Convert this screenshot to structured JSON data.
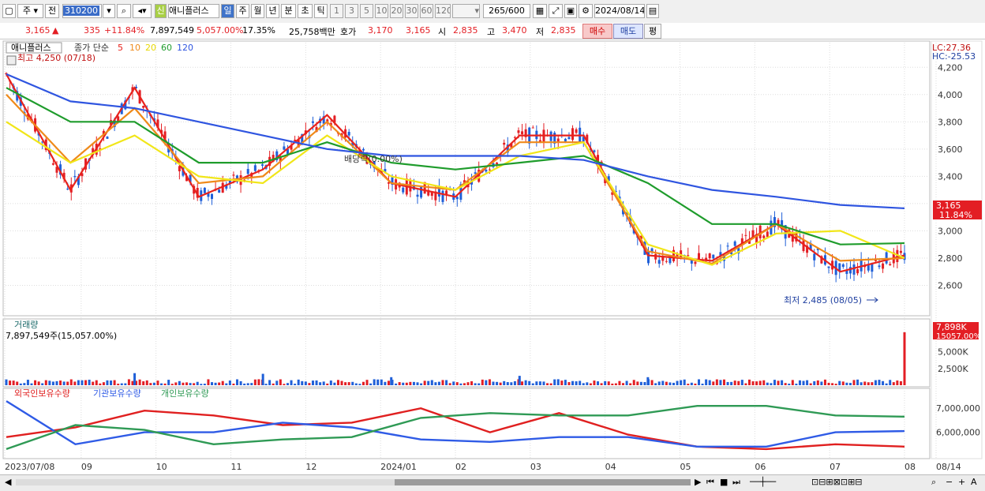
{
  "toolbar": {
    "market_label": "주",
    "prev_label": "전",
    "code": "310200",
    "new_badge": "신",
    "stock_name": "애니플러스",
    "periods": [
      "일",
      "주",
      "월",
      "년",
      "분",
      "초",
      "틱"
    ],
    "intervals": [
      "1",
      "3",
      "5",
      "10",
      "20",
      "30",
      "60",
      "120"
    ],
    "count": "265",
    "count_total": "/600",
    "date": "2024/08/14"
  },
  "quote": {
    "price": "3,165",
    "change": "335",
    "change_rate": "+11.84%",
    "volume": "7,897,549",
    "volume_rate": "5,057.00%",
    "turnover": "17.35%",
    "amount": "25,758백만",
    "bid_label": "호가",
    "ask_price": "3,170",
    "bid_price": "3,165",
    "open_label": "시",
    "open": "2,835",
    "high_label": "고",
    "high": "3,470",
    "low_label": "저",
    "low": "2,835",
    "buy_label": "매수",
    "sell_label": "매도",
    "eval_label": "평"
  },
  "price_panel": {
    "stock_label": "애니플러스",
    "ma_title": "종가 단순",
    "ma_periods": [
      "5",
      "10",
      "20",
      "60",
      "120"
    ],
    "high_marker": "최고 4,250 (07/18)",
    "low_marker": "최저 2,485 (08/05)",
    "dividend_marker": "배당락(0.00%)",
    "lc": "LC:27.36",
    "hc": "HC:-25.53",
    "price_tag": "3,165",
    "pct_tag": "11.84%",
    "y_ticks": [
      "4,200",
      "4,000",
      "3,800",
      "3,600",
      "3,400",
      "3,200",
      "3,000",
      "2,800",
      "2,600"
    ]
  },
  "volume_panel": {
    "title": "거래량",
    "value": "7,897,549주(15,057.00%)",
    "tag": "7,898K",
    "tag2": "15057.00%",
    "y_ticks": [
      "5,000K",
      "2,500K"
    ]
  },
  "holders_panel": {
    "legend": [
      "외국인보유수량",
      "기관보유수량",
      "개인보유수량"
    ],
    "y_ticks": [
      "7,000,000",
      "6,000,000"
    ]
  },
  "x_labels": [
    "2023/07/08",
    "09",
    "10",
    "11",
    "12",
    "2024/01",
    "02",
    "03",
    "04",
    "05",
    "06",
    "07",
    "08",
    "08/14"
  ],
  "colors": {
    "up": "#e31e24",
    "down": "#1f5fd8",
    "ma5": "#e8221c",
    "ma10": "#ef8a1a",
    "ma20": "#f1e619",
    "ma60": "#1f9c2c",
    "ma120": "#2f55e0",
    "foreign": "#e02020",
    "inst": "#2f5be6",
    "retail": "#2f9a55"
  },
  "chart_data": [
    {
      "type": "line",
      "title": "애니플러스",
      "x": [
        "2023/07",
        "2023/08",
        "2023/09",
        "2023/10",
        "2023/11",
        "2023/12",
        "2024/01",
        "2024/02",
        "2024/03",
        "2024/04",
        "2024/05",
        "2024/06",
        "2024/07",
        "2024/08",
        "2024/08/14"
      ],
      "series": [
        {
          "name": "5",
          "values": [
            4150,
            3300,
            4050,
            3250,
            3450,
            3850,
            3350,
            3250,
            3700,
            3700,
            2820,
            2780,
            3050,
            2700,
            2820
          ]
        },
        {
          "name": "10",
          "values": [
            4000,
            3500,
            3900,
            3350,
            3400,
            3800,
            3350,
            3300,
            3650,
            3650,
            2850,
            2760,
            3050,
            2780,
            2800
          ]
        },
        {
          "name": "20",
          "values": [
            3800,
            3500,
            3700,
            3400,
            3350,
            3700,
            3400,
            3300,
            3550,
            3650,
            2900,
            2750,
            2980,
            3000,
            2800
          ]
        },
        {
          "name": "60",
          "values": [
            4050,
            3800,
            3800,
            3500,
            3500,
            3650,
            3500,
            3450,
            3500,
            3550,
            3350,
            3050,
            3050,
            2900,
            2910
          ]
        },
        {
          "name": "120",
          "values": [
            4150,
            3950,
            3900,
            3800,
            3700,
            3600,
            3550,
            3550,
            3550,
            3520,
            3400,
            3300,
            3250,
            3190,
            3165
          ]
        }
      ],
      "ylim": [
        2400,
        4300
      ]
    },
    {
      "type": "bar",
      "title": "거래량",
      "x": [
        "2023/09",
        "2024/01",
        "2024/03",
        "2024/05",
        "2024/07",
        "2024/08/14"
      ],
      "series": [
        {
          "name": "거래량",
          "values": [
            1800,
            1700,
            1200,
            1400,
            1200,
            7898
          ]
        }
      ],
      "ylim": [
        0,
        8000
      ]
    },
    {
      "type": "line",
      "x": [
        "2023/07",
        "2023/08",
        "2023/09",
        "2023/10",
        "2023/11",
        "2023/12",
        "2024/01",
        "2024/02",
        "2024/03",
        "2024/04",
        "2024/05",
        "2024/06",
        "2024/07",
        "2024/08"
      ],
      "series": [
        {
          "name": "외국인보유수량",
          "values": [
            5800,
            6200,
            6900,
            6700,
            6300,
            6400,
            7000,
            6000,
            6800,
            5900,
            5400,
            5300,
            5500,
            5400
          ]
        },
        {
          "name": "기관보유수량",
          "values": [
            7300,
            5500,
            6000,
            6000,
            6400,
            6200,
            5700,
            5600,
            5800,
            5800,
            5400,
            5400,
            6000,
            6050
          ]
        },
        {
          "name": "개인보유수량",
          "values": [
            5300,
            6300,
            6100,
            5500,
            5700,
            5800,
            6600,
            6800,
            6700,
            6700,
            7100,
            7100,
            6700,
            6650
          ]
        }
      ],
      "ylim": [
        5000,
        7500
      ]
    }
  ]
}
